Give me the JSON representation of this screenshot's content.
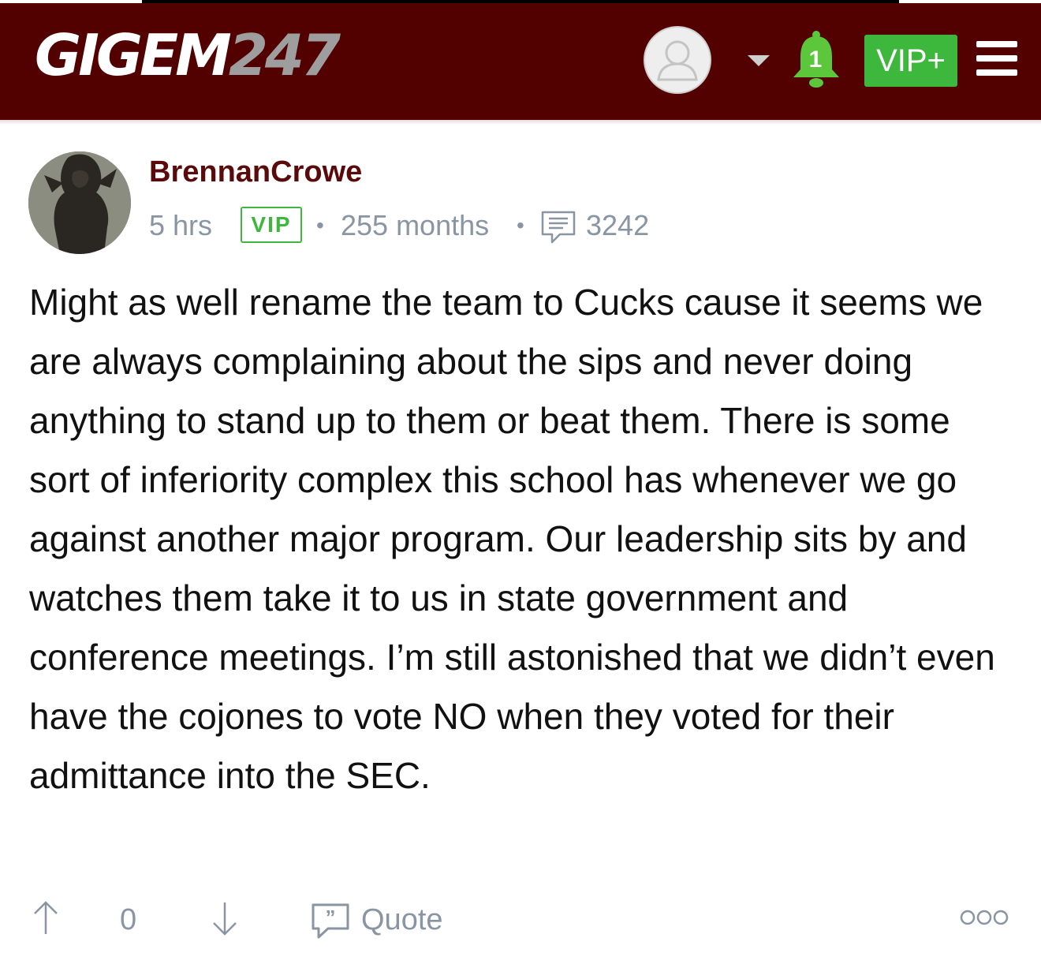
{
  "header": {
    "logo_primary": "GIGEM",
    "logo_secondary": "247",
    "notification_count": "1",
    "vip_button_label": "VIP+",
    "colors": {
      "header_bg": "#520000",
      "vip_green": "#3db83d",
      "bell_green": "#5cc73a"
    },
    "icons": [
      "user-avatar-icon",
      "chevron-down-icon",
      "bell-icon",
      "hamburger-menu-icon"
    ]
  },
  "post": {
    "username": "BrennanCrowe",
    "time": "5 hrs",
    "vip_badge": "VIP",
    "membership": "255 months",
    "post_count": "3242",
    "separator": "•",
    "body": "Might as well rename the team to Cucks cause it seems we are always complaining about the sips and never doing anything to stand up to them or beat them. There is some sort of inferiority complex this school has whenever we go against another major program. Our leadership sits by and watches them take it to us in state government and conference meetings. I’m still astonished that we didn’t even have the cojones to vote NO when they voted for their admittance into the SEC.",
    "colors": {
      "username": "#5a0a0a",
      "meta_gray": "#8a95a3"
    }
  },
  "actions": {
    "vote_count": "0",
    "quote_label": "Quote",
    "icons": [
      "arrow-up-icon",
      "arrow-down-icon",
      "quote-icon",
      "more-options-icon"
    ]
  }
}
